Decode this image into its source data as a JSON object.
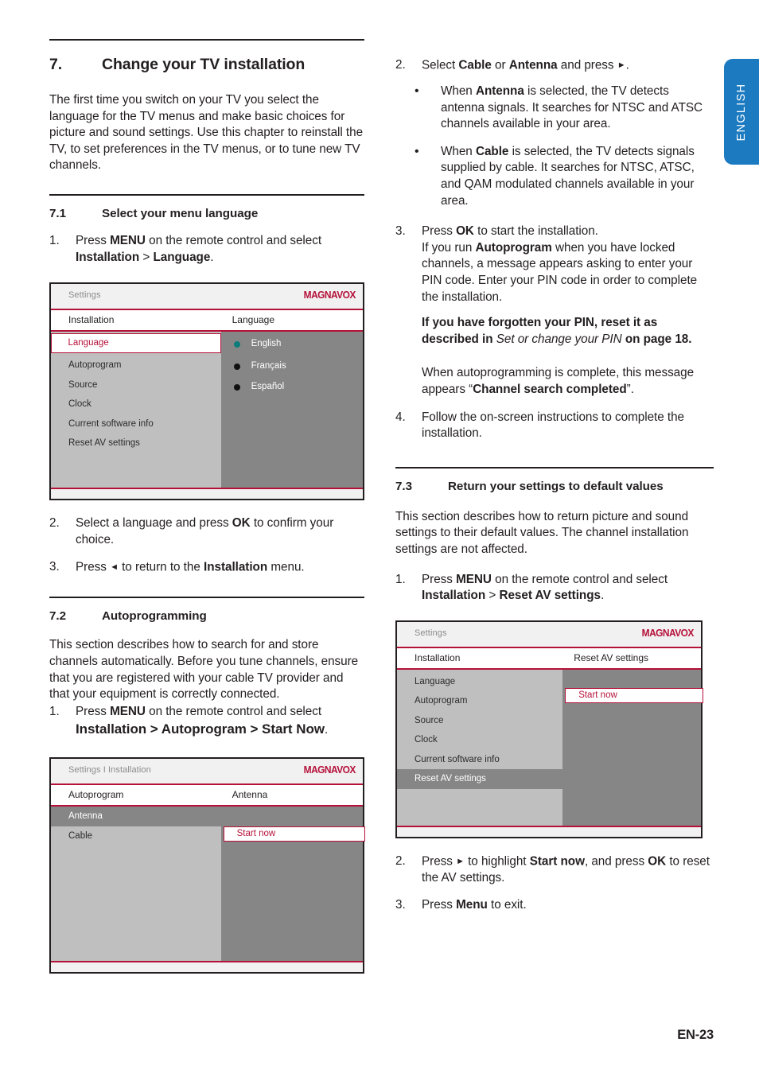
{
  "page": {
    "footer": "EN-23",
    "language_tab": "ENGLISH",
    "accent_red": "#b5123a",
    "tab_blue": "#1b7ac0",
    "radio_selected_color": "#0d7c7c"
  },
  "left_column": {
    "chapter": {
      "number": "7.",
      "title": "Change your TV installation"
    },
    "intro": "The first time you switch on your TV you select the language for the TV menus and make basic choices for picture and sound settings.  Use this chapter to reinstall the TV, to set preferences in the TV menus, or to tune new TV channels.",
    "section_71": {
      "number": "7.1",
      "title": "Select your menu language"
    },
    "step_71_1": {
      "marker": "1.",
      "prefix": "Press ",
      "bold1": "MENU",
      "mid": " on the remote control and select ",
      "bold2": "Installation",
      "gt": " > ",
      "bold3": "Language",
      "suffix": "."
    },
    "step_71_2": {
      "marker": "2.",
      "prefix": "Select a language and press ",
      "bold1": "OK",
      "suffix": " to confirm your choice."
    },
    "step_71_3": {
      "marker": "3.",
      "prefix": "Press ",
      "arrow": "◄",
      "mid": " to return to the ",
      "bold1": "Installation",
      "suffix": " menu."
    },
    "section_72": {
      "number": "7.2",
      "title": "Autoprogramming"
    },
    "para_72": "This section describes how to search for and store channels automatically.  Before you tune channels, ensure that you are registered with your cable TV provider and that your equipment is correctly connected.",
    "step_72_1": {
      "marker": "1.",
      "prefix": "Press ",
      "bold1": "MENU",
      "mid": " on the remote control and select ",
      "bold2": "Installation > Autoprogram > Start Now",
      "suffix": "."
    }
  },
  "right_column": {
    "step_72_2": {
      "marker": "2.",
      "prefix": "Select ",
      "bold1": "Cable",
      "mid1": " or ",
      "bold2": "Antenna",
      "mid2": " and press ",
      "arrow": "►",
      "suffix": "."
    },
    "bullet_antenna": {
      "marker": "•",
      "prefix": "When ",
      "bold1": "Antenna",
      "suffix": " is selected, the TV detects antenna signals.  It searches for NTSC and ATSC channels available in your area."
    },
    "bullet_cable": {
      "marker": "•",
      "prefix": "When ",
      "bold1": "Cable",
      "suffix": " is selected, the TV detects signals supplied by cable.  It searches for NTSC, ATSC, and QAM modulated channels available in your area."
    },
    "step_72_3": {
      "marker": "3.",
      "line1_prefix": "Press ",
      "line1_bold": "OK",
      "line1_suffix": " to start the installation.",
      "line2_prefix": "If you run ",
      "line2_bold": "Autoprogram",
      "line2_suffix": " when you have locked channels, a message appears asking to enter your PIN code.  Enter your PIN code in order to complete the installation.",
      "para2_bold1": "If you have forgotten your PIN, reset it as described in ",
      "para2_italic": "Set or change your PIN",
      "para2_bold2": " on page 18.",
      "para3_prefix": "When autoprogramming is complete, this message appears “",
      "para3_bold": "Channel search completed",
      "para3_suffix": "”."
    },
    "step_72_4": {
      "marker": "4.",
      "text": "Follow the on-screen instructions to complete the installation."
    },
    "section_73": {
      "number": "7.3",
      "title": "Return your settings to default values"
    },
    "para_73": "This section describes how to return picture and sound settings to their default values.  The channel installation settings are not affected.",
    "step_73_1": {
      "marker": "1.",
      "prefix": "Press ",
      "bold1": "MENU",
      "mid": " on the remote control and select ",
      "bold2": "Installation",
      "gt": " > ",
      "bold3": "Reset AV settings",
      "suffix": "."
    },
    "step_73_2": {
      "marker": "2.",
      "prefix": "Press ",
      "arrow": "►",
      "mid1": " to highlight ",
      "bold1": "Start now",
      "mid2": ", and press ",
      "bold2": "OK",
      "suffix": " to reset the AV settings."
    },
    "step_73_3": {
      "marker": "3.",
      "prefix": "Press ",
      "bold1": "Menu",
      "suffix": " to exit."
    }
  },
  "osd_language": {
    "breadcrumb": "Settings",
    "logo": "MAGNAVOX",
    "head_left": "Installation",
    "head_right": "Language",
    "menu_items": [
      "Language",
      "Autoprogram",
      "Source",
      "Clock",
      "Current software info",
      "Reset AV settings"
    ],
    "selected_item": "Language",
    "options": [
      {
        "label": "English",
        "selected": true
      },
      {
        "label": "Français",
        "selected": false
      },
      {
        "label": "Español",
        "selected": false
      }
    ]
  },
  "osd_autoprogram": {
    "breadcrumb": "Settings I Installation",
    "logo": "MAGNAVOX",
    "head_left": "Autoprogram",
    "head_right": "Antenna",
    "menu_items": [
      "Antenna",
      "Cable"
    ],
    "highlighted_item": "Antenna",
    "action_button": "Start now"
  },
  "osd_reset": {
    "breadcrumb": "Settings",
    "logo": "MAGNAVOX",
    "head_left": "Installation",
    "head_right": "Reset AV settings",
    "menu_items": [
      "Language",
      "Autoprogram",
      "Source",
      "Clock",
      "Current software info",
      "Reset AV settings"
    ],
    "highlighted_item": "Reset AV settings",
    "action_button": "Start now"
  }
}
